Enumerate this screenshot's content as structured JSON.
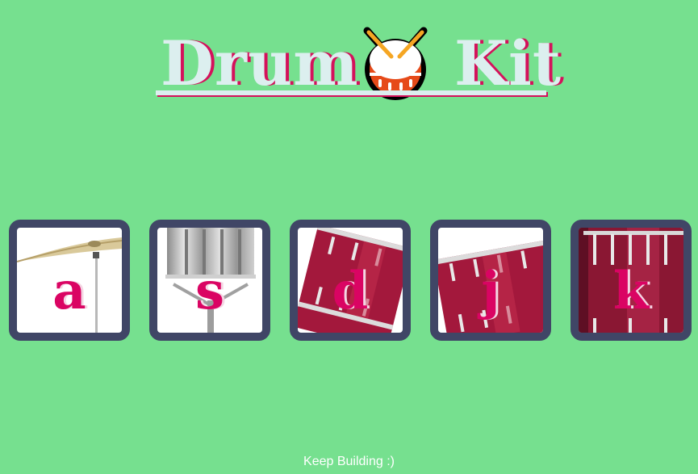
{
  "title": {
    "word_1": "Drum",
    "word_2": "Kit",
    "emoji_icon": "drum-icon"
  },
  "drums": [
    {
      "key": "a",
      "instrument_icon": "crash-cymbal-icon"
    },
    {
      "key": "s",
      "instrument_icon": "snare-drum-icon"
    },
    {
      "key": "d",
      "instrument_icon": "tom-drum-icon"
    },
    {
      "key": "j",
      "instrument_icon": "tom-drum-icon"
    },
    {
      "key": "k",
      "instrument_icon": "kick-drum-icon"
    }
  ],
  "footer": {
    "text": "Keep Building :)"
  },
  "colors": {
    "background": "#76e08f",
    "button_border": "#404666",
    "key_letter": "#da0463",
    "title_text": "#dcefef",
    "title_shadow": "#d4115b"
  }
}
